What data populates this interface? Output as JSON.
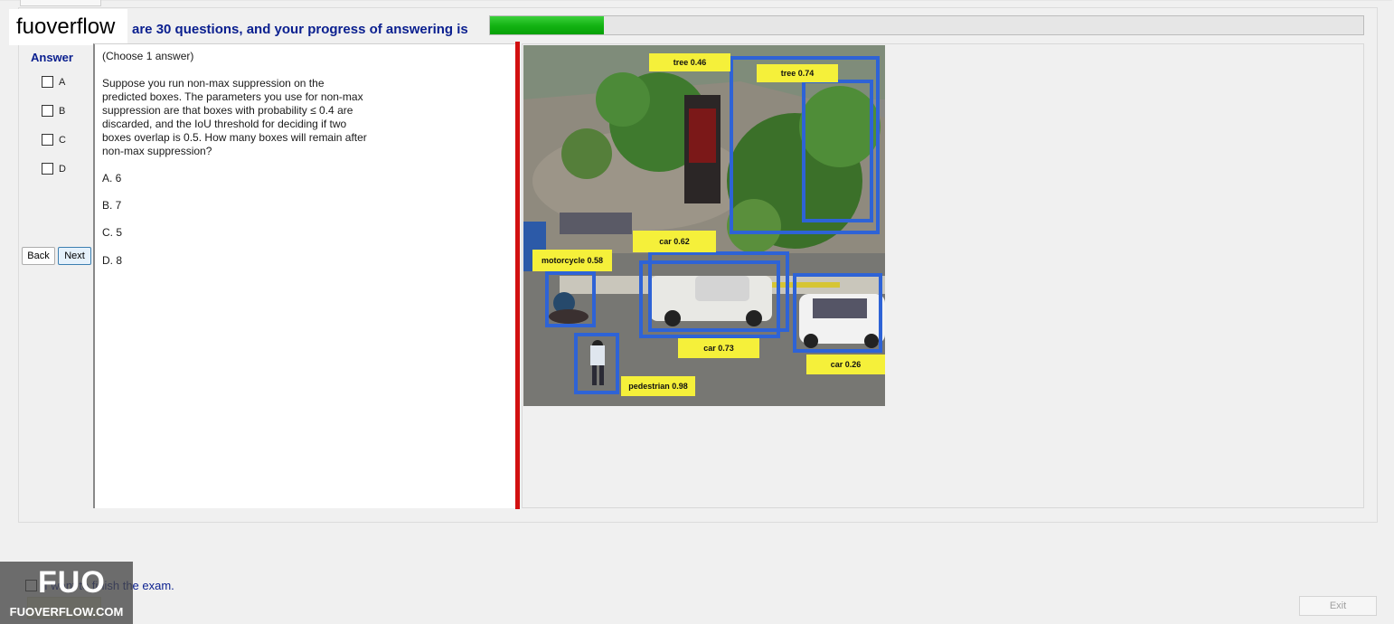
{
  "logo": {
    "text": "fuoverflow"
  },
  "header": {
    "progress_text": "are 30 questions, and your progress of answering is",
    "progress_fraction": 0.13
  },
  "answer_panel": {
    "title": "Answer",
    "options": [
      "A",
      "B",
      "C",
      "D"
    ],
    "back_label": "Back",
    "next_label": "Next"
  },
  "question": {
    "instruction": "(Choose 1 answer)",
    "body_lines": [
      "Suppose you run non-max suppression on the",
      "predicted boxes. The parameters you use for non-max",
      "suppression are that boxes with probability ≤ 0.4 are",
      "discarded, and the IoU threshold for deciding if two",
      "boxes overlap is 0.5. How many boxes will remain after",
      "non-max suppression?"
    ],
    "answers": [
      "A. 6",
      "B. 7",
      "C. 5",
      "D. 8"
    ]
  },
  "image": {
    "detections": [
      {
        "label": "tree 0.46"
      },
      {
        "label": "tree 0.74"
      },
      {
        "label": "car  0.62"
      },
      {
        "label": "motorcycle  0.58"
      },
      {
        "label": "car  0.73"
      },
      {
        "label": "car 0.26"
      },
      {
        "label": "pedestrian 0.98"
      }
    ]
  },
  "footer": {
    "finish_text": "I want to finish the exam.",
    "exit_label": "Exit"
  },
  "watermark": {
    "big": "FUO",
    "small": "FUOVERFLOW.COM"
  }
}
